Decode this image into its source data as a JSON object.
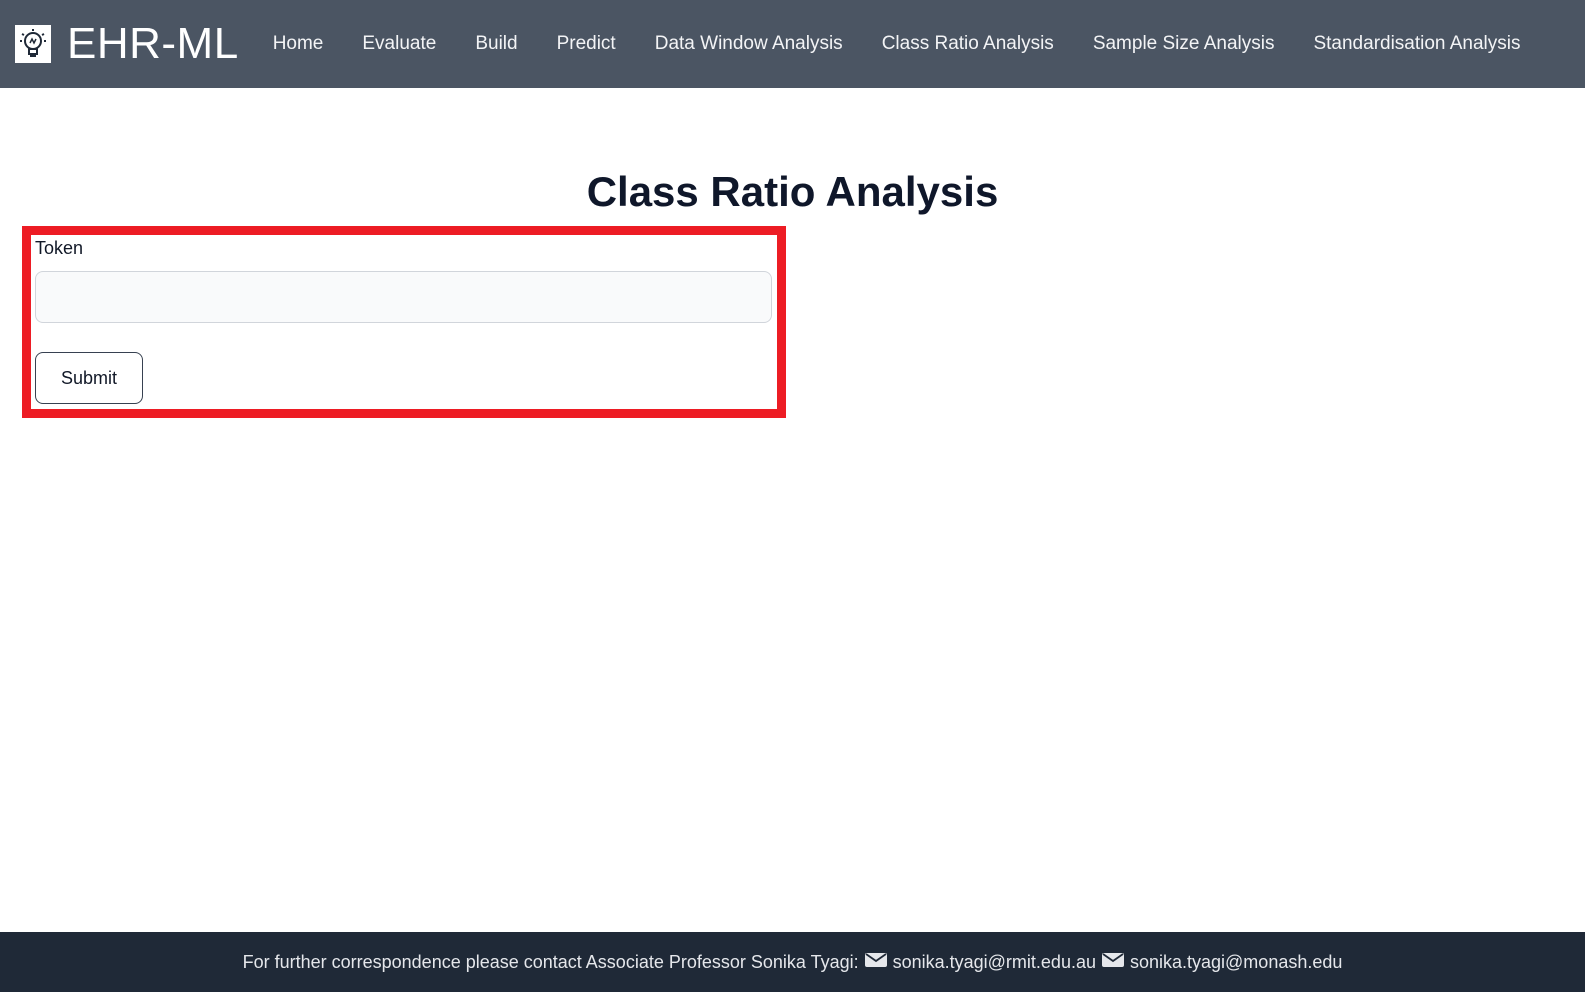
{
  "brand": {
    "name": "EHR-ML",
    "logo_icon": "lightbulb-icon"
  },
  "nav": {
    "items": [
      {
        "label": "Home"
      },
      {
        "label": "Evaluate"
      },
      {
        "label": "Build"
      },
      {
        "label": "Predict"
      },
      {
        "label": "Data Window Analysis"
      },
      {
        "label": "Class Ratio Analysis"
      },
      {
        "label": "Sample Size Analysis"
      },
      {
        "label": "Standardisation Analysis"
      }
    ]
  },
  "main": {
    "title": "Class Ratio Analysis",
    "form": {
      "token_label": "Token",
      "token_value": "",
      "token_placeholder": "",
      "submit_label": "Submit"
    }
  },
  "footer": {
    "text": "For further correspondence please contact Associate Professor Sonika Tyagi:",
    "email_1": "sonika.tyagi@rmit.edu.au",
    "email_2": "sonika.tyagi@monash.edu",
    "email_icon": "envelope-icon"
  },
  "colors": {
    "navbar": "#4b5563",
    "footer": "#1f2937",
    "highlight": "#ed1c24"
  }
}
